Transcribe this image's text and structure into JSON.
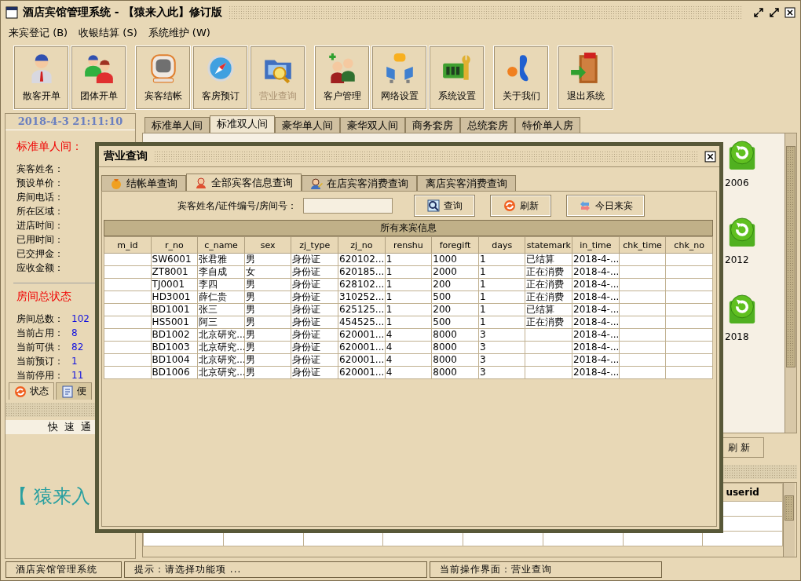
{
  "window": {
    "title": "酒店宾馆管理系统 - 【猿来入此】修订版"
  },
  "menu": [
    {
      "label": "来宾登记 (B)"
    },
    {
      "label": "收银结算 (S)"
    },
    {
      "label": "系统维护 (W)"
    }
  ],
  "toolbar_groups": [
    {
      "buttons": [
        {
          "label": "散客开单",
          "disabled": false
        },
        {
          "label": "团体开单",
          "disabled": false
        }
      ]
    },
    {
      "buttons": [
        {
          "label": "宾客结帐",
          "disabled": false
        },
        {
          "label": "客房预订",
          "disabled": false
        },
        {
          "label": "营业查询",
          "disabled": true
        }
      ]
    },
    {
      "buttons": [
        {
          "label": "客户管理",
          "disabled": false
        },
        {
          "label": "网络设置",
          "disabled": false
        },
        {
          "label": "系统设置",
          "disabled": false
        }
      ]
    },
    {
      "buttons": [
        {
          "label": "关于我们",
          "disabled": false
        }
      ]
    },
    {
      "buttons": [
        {
          "label": "退出系统",
          "disabled": false
        }
      ]
    }
  ],
  "clock": "2018-4-3  21:11:10",
  "room_info": {
    "title": "标准单人间：",
    "fields": [
      "宾客姓名：",
      "预设单价：",
      "房间电话：",
      "所在区域：",
      "进店时间：",
      "已用时间：",
      "已交押金：",
      "应收金额："
    ]
  },
  "room_status": {
    "title": "房间总状态",
    "stats": [
      {
        "label": "房间总数：",
        "value": "102"
      },
      {
        "label": "当前占用：",
        "value": "8"
      },
      {
        "label": "当前可供：",
        "value": "82"
      },
      {
        "label": "当前预订：",
        "value": "1"
      },
      {
        "label": "当前停用：",
        "value": "11"
      }
    ]
  },
  "left_tabs": [
    {
      "label": "状态",
      "selected": true
    },
    {
      "label": "便",
      "selected": false
    }
  ],
  "quick_access": {
    "title": "快 速 通",
    "logo": "【 猿来入"
  },
  "room_tabs": [
    {
      "label": "标准单人间",
      "selected": false
    },
    {
      "label": "标准双人间",
      "selected": true
    },
    {
      "label": "豪华单人间",
      "selected": false
    },
    {
      "label": "豪华双人间",
      "selected": false
    },
    {
      "label": "商务套房",
      "selected": false
    },
    {
      "label": "总统套房",
      "selected": false
    },
    {
      "label": "特价单人房",
      "selected": false
    }
  ],
  "rooms": [
    {
      "number": "2006"
    },
    {
      "number": "2012"
    },
    {
      "number": "2018"
    }
  ],
  "refresh_button": "刷 新",
  "bottom_table": {
    "columns": [
      "userid"
    ]
  },
  "status_bar": [
    "酒店宾馆管理系统",
    "提示：请选择功能项 ...",
    "当前操作界面：营业查询"
  ],
  "dialog": {
    "title": "营业查询",
    "tabs": [
      {
        "label": "结帐单查询",
        "selected": false
      },
      {
        "label": "全部宾客信息查询",
        "selected": true
      },
      {
        "label": "在店宾客消费查询",
        "selected": false
      },
      {
        "label": "离店宾客消费查询",
        "selected": false
      }
    ],
    "search": {
      "label": "宾客姓名/证件编号/房间号："
    },
    "buttons": [
      {
        "label": "查询"
      },
      {
        "label": "刷新"
      },
      {
        "label": "今日来宾"
      }
    ],
    "table": {
      "caption": "所有来宾信息",
      "columns": [
        "m_id",
        "r_no",
        "c_name",
        "sex",
        "zj_type",
        "zj_no",
        "renshu",
        "foregift",
        "days",
        "statemark",
        "in_time",
        "chk_time",
        "chk_no"
      ],
      "rows": [
        {
          "r_no": "SW6001",
          "c_name": "张君雅",
          "sex": "男",
          "zj_type": "身份证",
          "zj_no": "620102...",
          "renshu": "1",
          "foregift": "1000",
          "days": "1",
          "statemark": "已结算",
          "in_time": "2018-4-..."
        },
        {
          "r_no": "ZT8001",
          "c_name": "李自成",
          "sex": "女",
          "zj_type": "身份证",
          "zj_no": "620185...",
          "renshu": "1",
          "foregift": "2000",
          "days": "1",
          "statemark": "正在消费",
          "in_time": "2018-4-..."
        },
        {
          "r_no": "TJ0001",
          "c_name": "李四",
          "sex": "男",
          "zj_type": "身份证",
          "zj_no": "628102...",
          "renshu": "1",
          "foregift": "200",
          "days": "1",
          "statemark": "正在消费",
          "in_time": "2018-4-..."
        },
        {
          "r_no": "HD3001",
          "c_name": "薛仁贵",
          "sex": "男",
          "zj_type": "身份证",
          "zj_no": "310252...",
          "renshu": "1",
          "foregift": "500",
          "days": "1",
          "statemark": "正在消费",
          "in_time": "2018-4-..."
        },
        {
          "r_no": "BD1001",
          "c_name": "张三",
          "sex": "男",
          "zj_type": "身份证",
          "zj_no": "625125...",
          "renshu": "1",
          "foregift": "200",
          "days": "1",
          "statemark": "已结算",
          "in_time": "2018-4-..."
        },
        {
          "r_no": "HS5001",
          "c_name": "阿三",
          "sex": "男",
          "zj_type": "身份证",
          "zj_no": "454525...",
          "renshu": "1",
          "foregift": "500",
          "days": "1",
          "statemark": "正在消费",
          "in_time": "2018-4-..."
        },
        {
          "r_no": "BD1002",
          "c_name": "北京研究...",
          "sex": "男",
          "zj_type": "身份证",
          "zj_no": "620001...",
          "renshu": "4",
          "foregift": "8000",
          "days": "3",
          "in_time": "2018-4-..."
        },
        {
          "r_no": "BD1003",
          "c_name": "北京研究...",
          "sex": "男",
          "zj_type": "身份证",
          "zj_no": "620001...",
          "renshu": "4",
          "foregift": "8000",
          "days": "3",
          "in_time": "2018-4-..."
        },
        {
          "r_no": "BD1004",
          "c_name": "北京研究...",
          "sex": "男",
          "zj_type": "身份证",
          "zj_no": "620001...",
          "renshu": "4",
          "foregift": "8000",
          "days": "3",
          "in_time": "2018-4-..."
        },
        {
          "r_no": "BD1006",
          "c_name": "北京研究...",
          "sex": "男",
          "zj_type": "身份证",
          "zj_no": "620001...",
          "renshu": "4",
          "foregift": "8000",
          "days": "3",
          "in_time": "2018-4-..."
        }
      ]
    }
  }
}
